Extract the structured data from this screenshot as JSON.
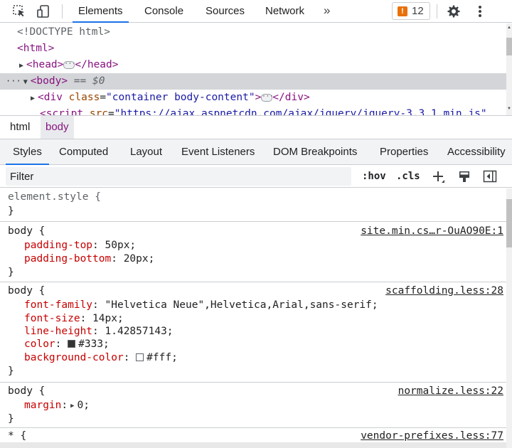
{
  "toolbar": {
    "tabs": [
      "Elements",
      "Console",
      "Sources",
      "Network"
    ],
    "more": "»",
    "issues_count": "12",
    "icons": [
      "inspect-element-icon",
      "device-toolbar-icon",
      "issues-icon",
      "gear-icon",
      "kebab-menu-icon"
    ]
  },
  "tree": {
    "doctype": "<!DOCTYPE html>",
    "html_open": "<html>",
    "head_open": "<head>",
    "head_close": "</head>",
    "body_open": "<body>",
    "body_eq": " == $0",
    "div_open_tag": "<div ",
    "div_attr_name": "class",
    "div_attr_value": "\"container body-content\"",
    "div_open_end": ">",
    "div_close": "</div>",
    "script_open": "<script ",
    "script_attr_name": "src",
    "script_attr_value": "\"https://ajax.aspnetcdn.com/ajax/jquery/jquery-3.3.1.min.js\""
  },
  "breadcrumb": [
    "html",
    "body"
  ],
  "subtabs": [
    "Styles",
    "Computed",
    "Layout",
    "Event Listeners",
    "DOM Breakpoints",
    "Properties",
    "Accessibility"
  ],
  "filter": {
    "placeholder": "Filter",
    "hov": ":hov",
    "cls": ".cls"
  },
  "rules": [
    {
      "selector": "element.style {",
      "close": "}",
      "source": ""
    },
    {
      "selector": "body {",
      "source": "site.min.cs…r-OuAO90E:1",
      "props": [
        {
          "name": "padding-top",
          "value": "50px;"
        },
        {
          "name": "padding-bottom",
          "value": "20px;"
        }
      ],
      "close": "}"
    },
    {
      "selector": "body {",
      "source": "scaffolding.less:28",
      "props": [
        {
          "name": "font-family",
          "value": "\"Helvetica Neue\",Helvetica,Arial,sans-serif;"
        },
        {
          "name": "font-size",
          "value": "14px;"
        },
        {
          "name": "line-height",
          "value": "1.42857143;"
        },
        {
          "name": "color",
          "value": "#333;",
          "swatch": "#333333"
        },
        {
          "name": "background-color",
          "value": "#fff;",
          "swatch": "#ffffff"
        }
      ],
      "close": "}"
    },
    {
      "selector": "body {",
      "source": "normalize.less:22",
      "props": [
        {
          "name": "margin",
          "value": "0;"
        }
      ],
      "close": "}"
    },
    {
      "selector": "* {",
      "source": "vendor-prefixes.less:77",
      "props": [],
      "close": ""
    }
  ],
  "colors": {
    "accent": "#1a73e8",
    "tag": "#881280",
    "prop_name": "#c80000",
    "issue": "#e8710a"
  }
}
